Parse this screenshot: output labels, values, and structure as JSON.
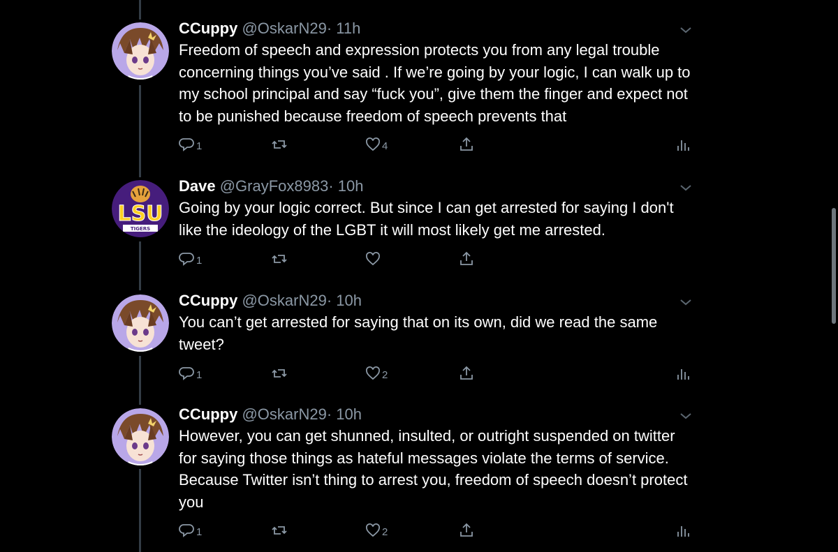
{
  "tweets": [
    {
      "name": "CCuppy",
      "handle": "@OskarN29",
      "time": "· 11h",
      "text": "Freedom of speech and expression protects you from any legal trouble concerning things you’ve said . If we’re going by your logic, I can walk up to my school principal and say “fuck you”, give them the finger and expect not to be punished because freedom of speech prevents that",
      "replies": "1",
      "retweets": "",
      "likes": "4",
      "avatar": "anime-avatar"
    },
    {
      "name": "Dave",
      "handle": "@GrayFox8983",
      "time": "· 10h",
      "text": "Going by your logic correct. But since I can get arrested for saying I don't like the ideology of the LGBT it will most likely get me arrested.",
      "replies": "1",
      "retweets": "",
      "likes": "",
      "avatar": "lsu-tigers-logo",
      "avatar_text": "LSU",
      "avatar_subtext": "TIGERS"
    },
    {
      "name": "CCuppy",
      "handle": "@OskarN29",
      "time": "· 10h",
      "text": "You can’t get arrested for saying that on its own, did we read the same tweet?",
      "replies": "1",
      "retweets": "",
      "likes": "2",
      "avatar": "anime-avatar"
    },
    {
      "name": "CCuppy",
      "handle": "@OskarN29",
      "time": "· 10h",
      "text": "However, you can get shunned, insulted, or outright suspended on twitter for saying those things as hateful messages violate the terms of service. Because Twitter isn’t thing to arrest you, freedom of speech doesn’t protect you",
      "replies": "1",
      "retweets": "",
      "likes": "2",
      "avatar": "anime-avatar"
    }
  ],
  "colors": {
    "background": "#000000",
    "secondary_text": "#8b98a5",
    "thread_line": "#333c45",
    "lsu_purple": "#461d7c",
    "lsu_gold": "#fdd023"
  },
  "icons": [
    "reply-icon",
    "retweet-icon",
    "like-icon",
    "share-icon",
    "analytics-icon",
    "chevron-down-icon"
  ]
}
